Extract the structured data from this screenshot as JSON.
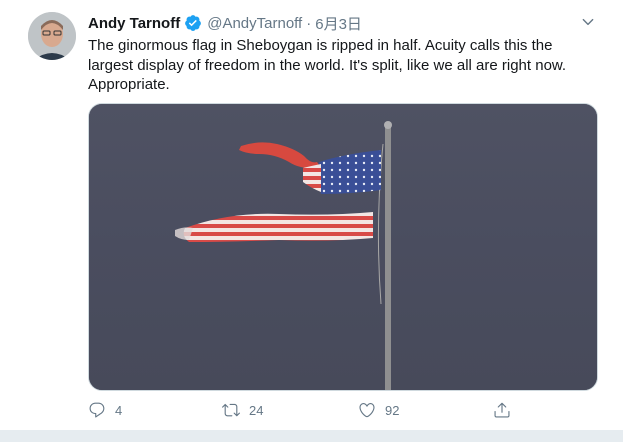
{
  "tweet": {
    "author_name": "Andy Tarnoff",
    "author_handle": "@AndyTarnoff",
    "separator": "·",
    "timestamp": "6月3日",
    "verified": true,
    "text": "The ginormous flag in Sheboygan is ripped in half. Acuity calls this the\nlargest display of freedom in the world. It's split, like we all are right now.\nAppropriate.",
    "media_icon": "photo-flag-on-pole",
    "actions": {
      "reply_icon": "reply-icon",
      "reply_count": "4",
      "retweet_icon": "retweet-icon",
      "retweet_count": "24",
      "like_icon": "heart-icon",
      "like_count": "92",
      "share_icon": "share-icon"
    }
  },
  "colors": {
    "accent": "#1da1f2",
    "muted": "#657786",
    "text": "#14171a",
    "sky": "#4b4e5e"
  }
}
